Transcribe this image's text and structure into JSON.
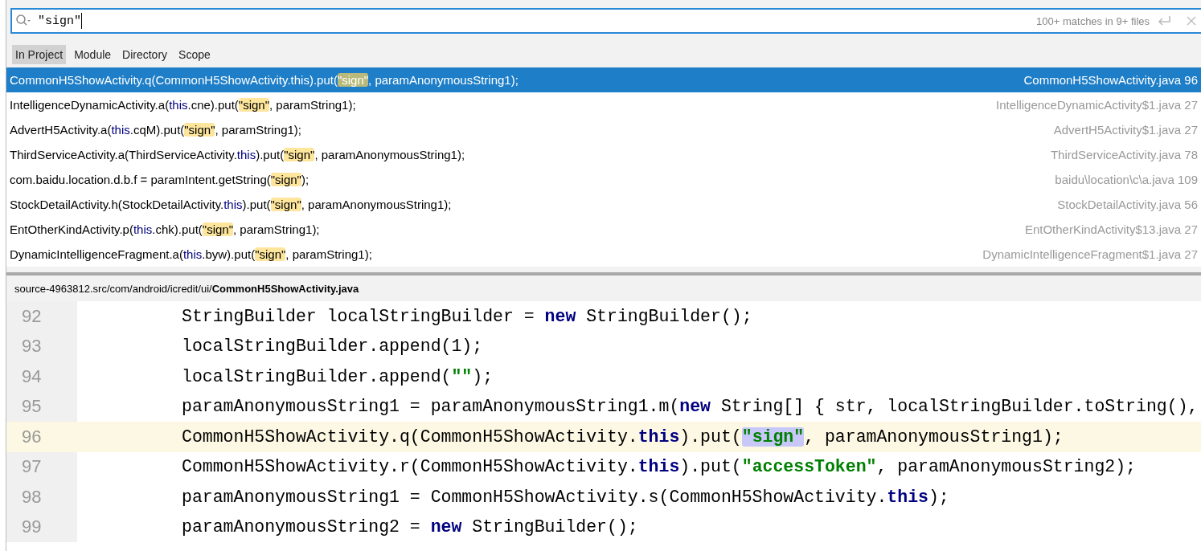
{
  "search": {
    "value": "\"sign\"",
    "summary": "100+ matches in 9+ files"
  },
  "scopes": [
    {
      "label": "In Project",
      "selected": true
    },
    {
      "label": "Module",
      "selected": false
    },
    {
      "label": "Directory",
      "selected": false
    },
    {
      "label": "Scope",
      "selected": false
    }
  ],
  "results": [
    {
      "selected": true,
      "segments": [
        {
          "kind": "plain",
          "text": "CommonH5ShowActivity.q(CommonH5ShowActivity.this).put("
        },
        {
          "kind": "match",
          "text": "\"sign\""
        },
        {
          "kind": "plain",
          "text": ", paramAnonymousString1);"
        }
      ],
      "location": "CommonH5ShowActivity.java 96"
    },
    {
      "selected": false,
      "segments": [
        {
          "kind": "plain",
          "text": "IntelligenceDynamicActivity.a("
        },
        {
          "kind": "keyword",
          "text": "this"
        },
        {
          "kind": "plain",
          "text": ".cne).put("
        },
        {
          "kind": "match",
          "text": "\"sign\""
        },
        {
          "kind": "plain",
          "text": ", paramString1);"
        }
      ],
      "location": "IntelligenceDynamicActivity$1.java 27"
    },
    {
      "selected": false,
      "segments": [
        {
          "kind": "plain",
          "text": "AdvertH5Activity.a("
        },
        {
          "kind": "keyword",
          "text": "this"
        },
        {
          "kind": "plain",
          "text": ".cqM).put("
        },
        {
          "kind": "match",
          "text": "\"sign\""
        },
        {
          "kind": "plain",
          "text": ", paramString1);"
        }
      ],
      "location": "AdvertH5Activity$1.java 27"
    },
    {
      "selected": false,
      "segments": [
        {
          "kind": "plain",
          "text": "ThirdServiceActivity.a(ThirdServiceActivity."
        },
        {
          "kind": "keyword",
          "text": "this"
        },
        {
          "kind": "plain",
          "text": ").put("
        },
        {
          "kind": "match",
          "text": "\"sign\""
        },
        {
          "kind": "plain",
          "text": ", paramAnonymousString1);"
        }
      ],
      "location": "ThirdServiceActivity.java 78"
    },
    {
      "selected": false,
      "segments": [
        {
          "kind": "plain",
          "text": "com.baidu.location.d.b.f = paramIntent.getString("
        },
        {
          "kind": "match",
          "text": "\"sign\""
        },
        {
          "kind": "plain",
          "text": ");"
        }
      ],
      "location": "baidu\\location\\c\\a.java 109"
    },
    {
      "selected": false,
      "segments": [
        {
          "kind": "plain",
          "text": "StockDetailActivity.h(StockDetailActivity."
        },
        {
          "kind": "keyword",
          "text": "this"
        },
        {
          "kind": "plain",
          "text": ").put("
        },
        {
          "kind": "match",
          "text": "\"sign\""
        },
        {
          "kind": "plain",
          "text": ", paramAnonymousString1);"
        }
      ],
      "location": "StockDetailActivity.java 56"
    },
    {
      "selected": false,
      "segments": [
        {
          "kind": "plain",
          "text": "EntOtherKindActivity.p("
        },
        {
          "kind": "keyword",
          "text": "this"
        },
        {
          "kind": "plain",
          "text": ".chk).put("
        },
        {
          "kind": "match",
          "text": "\"sign\""
        },
        {
          "kind": "plain",
          "text": ", paramString1);"
        }
      ],
      "location": "EntOtherKindActivity$13.java 27"
    },
    {
      "selected": false,
      "segments": [
        {
          "kind": "plain",
          "text": "DynamicIntelligenceFragment.a("
        },
        {
          "kind": "keyword",
          "text": "this"
        },
        {
          "kind": "plain",
          "text": ".byw).put("
        },
        {
          "kind": "match",
          "text": "\"sign\""
        },
        {
          "kind": "plain",
          "text": ", paramString1);"
        }
      ],
      "location": "DynamicIntelligenceFragment$1.java 27"
    }
  ],
  "preview": {
    "path": "source-4963812.src/com/android/icredit/ui/",
    "file": "CommonH5ShowActivity.java",
    "lines": [
      {
        "number": "92",
        "current": false,
        "segments": [
          {
            "kind": "plain",
            "text": "StringBuilder localStringBuilder = "
          },
          {
            "kind": "keyword",
            "text": "new"
          },
          {
            "kind": "plain",
            "text": " StringBuilder();"
          }
        ]
      },
      {
        "number": "93",
        "current": false,
        "segments": [
          {
            "kind": "plain",
            "text": "localStringBuilder.append(1);"
          }
        ]
      },
      {
        "number": "94",
        "current": false,
        "segments": [
          {
            "kind": "plain",
            "text": "localStringBuilder.append("
          },
          {
            "kind": "string",
            "text": "\"\""
          },
          {
            "kind": "plain",
            "text": ");"
          }
        ]
      },
      {
        "number": "95",
        "current": false,
        "segments": [
          {
            "kind": "plain",
            "text": "paramAnonymousString1 = paramAnonymousString1.m("
          },
          {
            "kind": "keyword",
            "text": "new"
          },
          {
            "kind": "plain",
            "text": " String[] { str, localStringBuilder.toString(),"
          }
        ]
      },
      {
        "number": "96",
        "current": true,
        "segments": [
          {
            "kind": "plain",
            "text": "CommonH5ShowActivity.q(CommonH5ShowActivity."
          },
          {
            "kind": "keyword",
            "text": "this"
          },
          {
            "kind": "plain",
            "text": ").put("
          },
          {
            "kind": "match",
            "text": "\"sign\""
          },
          {
            "kind": "plain",
            "text": ", paramAnonymousString1);"
          }
        ]
      },
      {
        "number": "97",
        "current": false,
        "segments": [
          {
            "kind": "plain",
            "text": "CommonH5ShowActivity.r(CommonH5ShowActivity."
          },
          {
            "kind": "keyword",
            "text": "this"
          },
          {
            "kind": "plain",
            "text": ").put("
          },
          {
            "kind": "string",
            "text": "\"accessToken\""
          },
          {
            "kind": "plain",
            "text": ", paramAnonymousString2);"
          }
        ]
      },
      {
        "number": "98",
        "current": false,
        "segments": [
          {
            "kind": "plain",
            "text": "paramAnonymousString1 = CommonH5ShowActivity.s(CommonH5ShowActivity."
          },
          {
            "kind": "keyword",
            "text": "this"
          },
          {
            "kind": "plain",
            "text": ");"
          }
        ]
      },
      {
        "number": "99",
        "current": false,
        "segments": [
          {
            "kind": "plain",
            "text": "paramAnonymousString2 = "
          },
          {
            "kind": "keyword",
            "text": "new"
          },
          {
            "kind": "plain",
            "text": " StringBuilder();"
          }
        ]
      }
    ]
  }
}
